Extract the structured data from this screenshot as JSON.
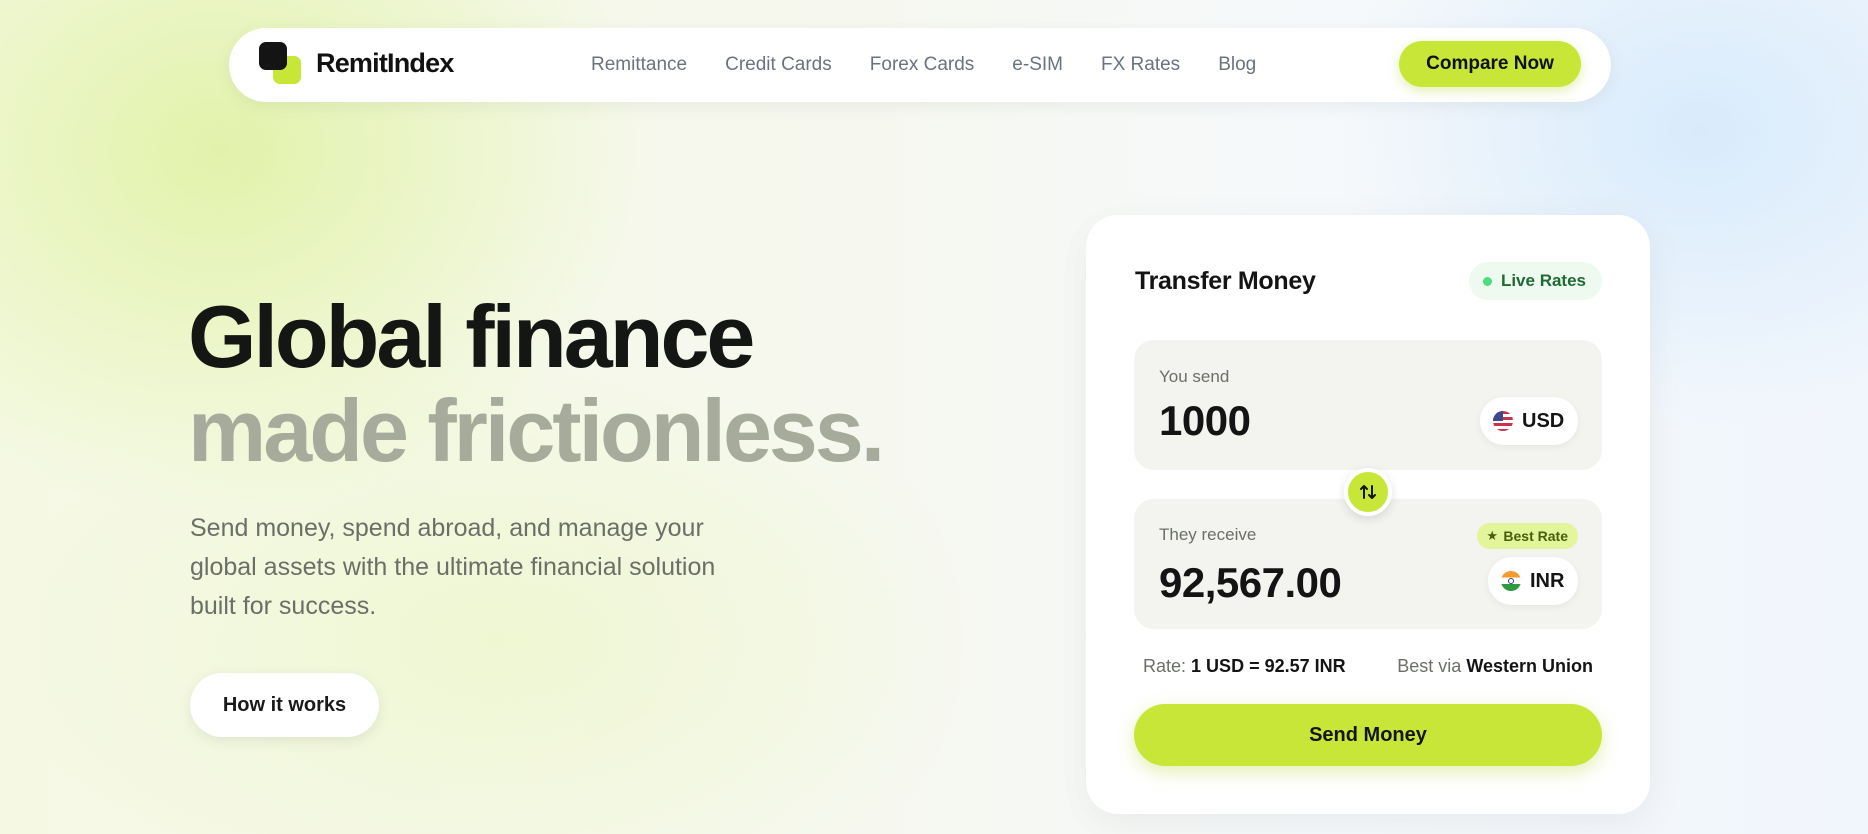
{
  "nav": {
    "brand": "RemitIndex",
    "links": [
      "Remittance",
      "Credit Cards",
      "Forex Cards",
      "e-SIM",
      "FX Rates",
      "Blog"
    ],
    "cta": "Compare Now"
  },
  "hero": {
    "title_line1": "Global finance",
    "title_line2": "made frictionless.",
    "subtitle": "Send money, spend abroad, and manage your global assets with the ultimate financial solution built for success.",
    "button": "How it works"
  },
  "card": {
    "title": "Transfer Money",
    "live_badge": "Live Rates",
    "send": {
      "label": "You send",
      "amount": "1000",
      "currency": "USD",
      "flag_icon": "us-flag-icon"
    },
    "receive": {
      "label": "They receive",
      "amount": "92,567.00",
      "currency": "INR",
      "flag_icon": "india-flag-icon",
      "badge": "Best Rate"
    },
    "rate_label": "Rate:",
    "rate_value": "1 USD = 92.57 INR",
    "best_via_label": "Best via",
    "best_via_value": "Western Union",
    "button": "Send Money"
  },
  "colors": {
    "accent": "#c8e637",
    "live_dot": "#4ade80",
    "title_dark": "#141614",
    "title_muted": "#a6ab9b"
  }
}
